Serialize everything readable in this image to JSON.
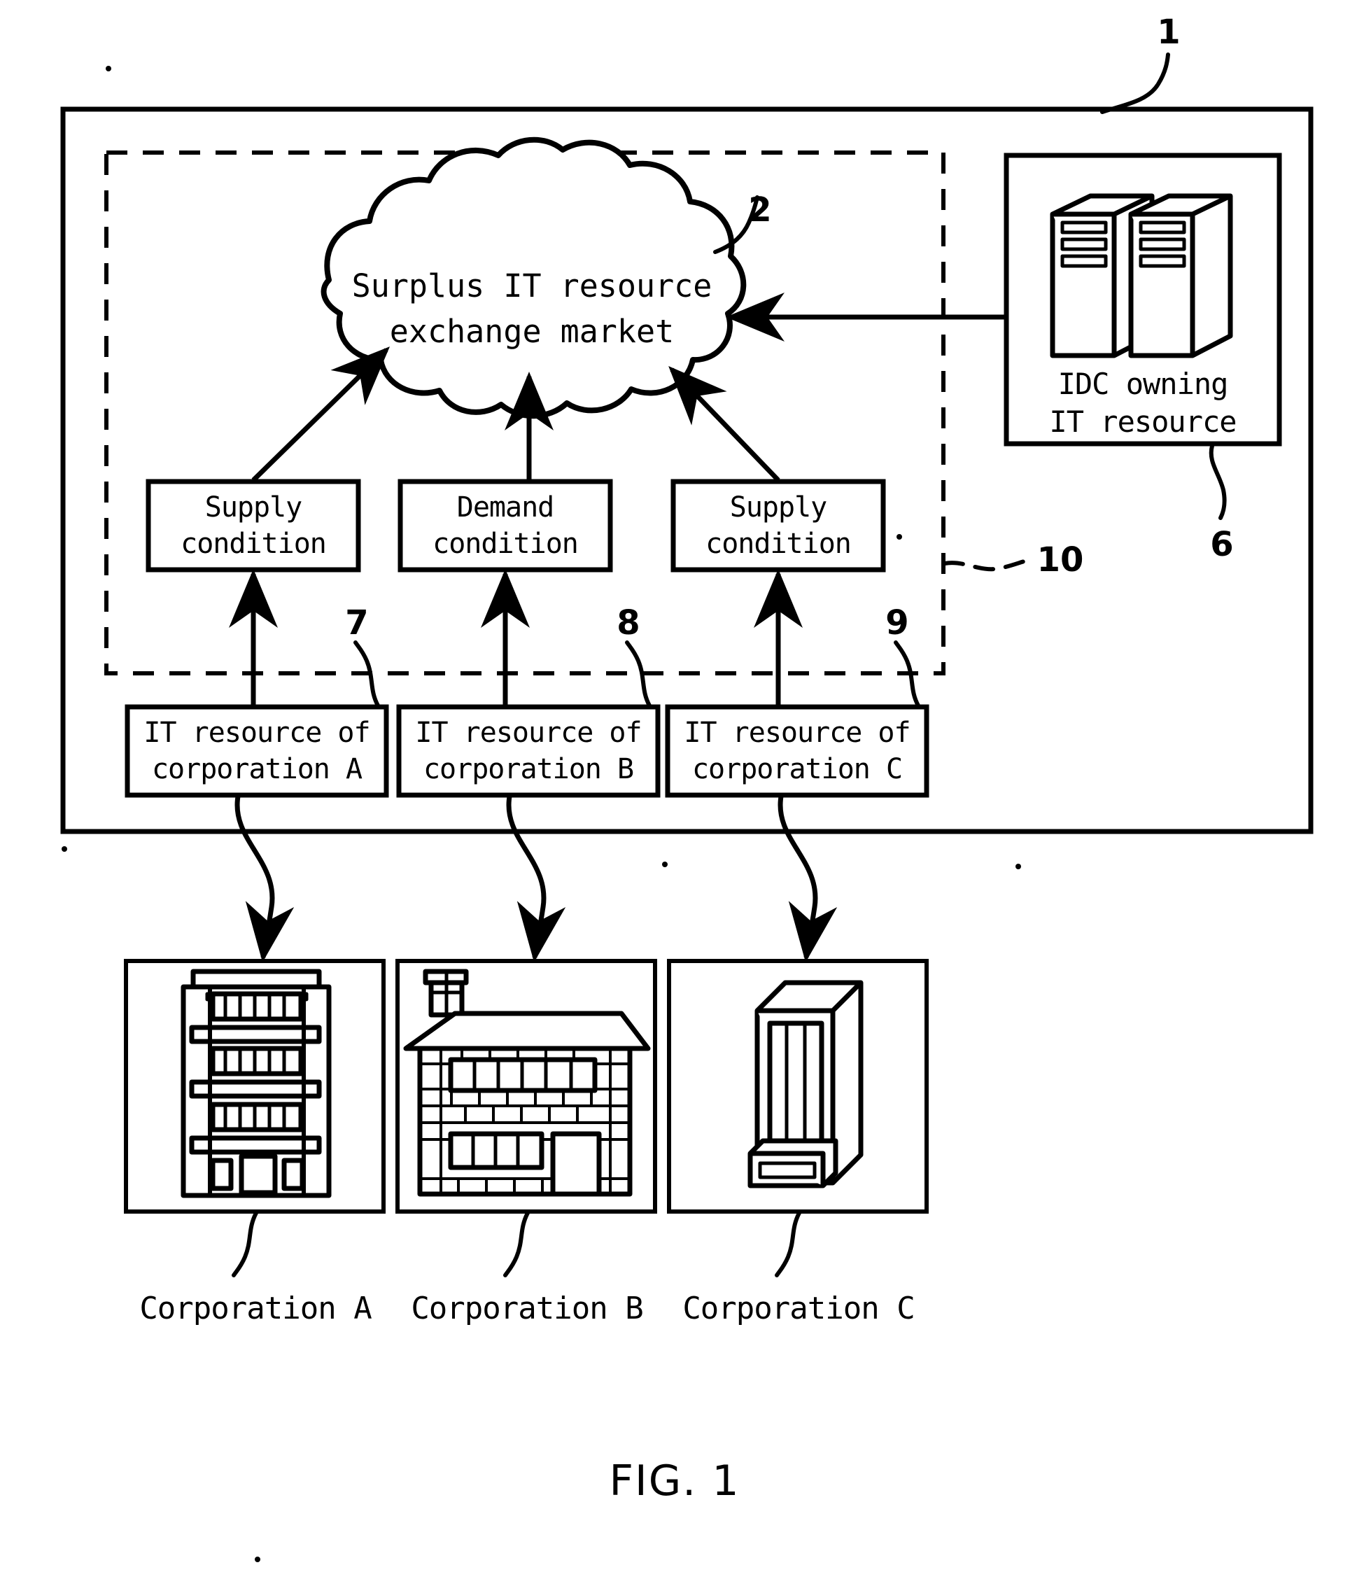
{
  "figure": {
    "caption": "FIG. 1",
    "title": "Surplus IT resource exchange market system diagram"
  },
  "cloud": {
    "line1": "Surplus IT resource",
    "line2": "exchange market",
    "ref": "2"
  },
  "outer_system": {
    "ref": "1"
  },
  "dashed_group": {
    "ref": "10"
  },
  "idc": {
    "line1": "IDC owning",
    "line2": "IT resource",
    "ref": "6",
    "icon": "server-rack-pair-icon"
  },
  "condition_boxes": [
    {
      "line1": "Supply",
      "line2": "condition",
      "name": "supply-condition-a"
    },
    {
      "line1": "Demand",
      "line2": "condition",
      "name": "demand-condition-b"
    },
    {
      "line1": "Supply",
      "line2": "condition",
      "name": "supply-condition-c"
    }
  ],
  "resource_boxes": [
    {
      "line1": "IT resource of",
      "line2": "corporation A",
      "ref": "7"
    },
    {
      "line1": "IT resource of",
      "line2": "corporation B",
      "ref": "8"
    },
    {
      "line1": "IT resource of",
      "line2": "corporation C",
      "ref": "9"
    }
  ],
  "corporations": [
    {
      "label": "Corporation A",
      "icon": "office-building-icon"
    },
    {
      "label": "Corporation B",
      "icon": "brick-house-icon"
    },
    {
      "label": "Corporation C",
      "icon": "server-tower-icon"
    }
  ],
  "colors": {
    "ink": "#000000",
    "paper": "#ffffff"
  }
}
